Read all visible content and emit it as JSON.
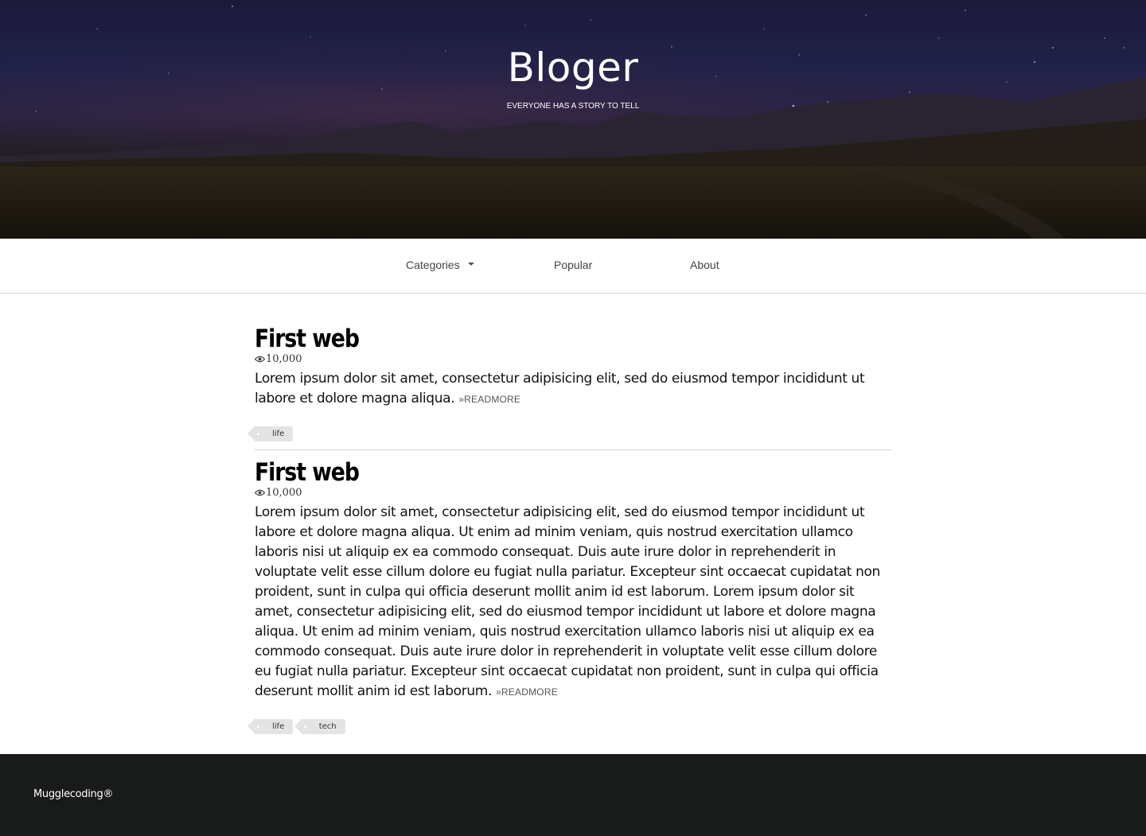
{
  "header": {
    "title": "Bloger",
    "tagline": "EVERYONE HAS A STORY TO TELL"
  },
  "nav": {
    "items": [
      {
        "label": "Categories",
        "icon": "caret-down-icon"
      },
      {
        "label": "Popular"
      },
      {
        "label": "About"
      }
    ]
  },
  "posts": [
    {
      "title": "First web",
      "views": "10,000",
      "excerpt": "Lorem ipsum dolor sit amet, consectetur adipisicing elit, sed do eiusmod tempor incididunt ut labore et dolore magna aliqua.",
      "readmore": "»READMORE",
      "tags": [
        "life"
      ]
    },
    {
      "title": "First web",
      "views": "10,000",
      "excerpt": "Lorem ipsum dolor sit amet, consectetur adipisicing elit, sed do eiusmod tempor incididunt ut labore et dolore magna aliqua. Ut enim ad minim veniam, quis nostrud exercitation ullamco laboris nisi ut aliquip ex ea commodo consequat. Duis aute irure dolor in reprehenderit in voluptate velit esse cillum dolore eu fugiat nulla pariatur. Excepteur sint occaecat cupidatat non proident, sunt in culpa qui officia deserunt mollit anim id est laborum. Lorem ipsum dolor sit amet, consectetur adipisicing elit, sed do eiusmod tempor incididunt ut labore et dolore magna aliqua. Ut enim ad minim veniam, quis nostrud exercitation ullamco laboris nisi ut aliquip ex ea commodo consequat. Duis aute irure dolor in reprehenderit in voluptate velit esse cillum dolore eu fugiat nulla pariatur. Excepteur sint occaecat cupidatat non proident, sunt in culpa qui officia deserunt mollit anim id est laborum.",
      "readmore": "»READMORE",
      "tags": [
        "life",
        "tech"
      ]
    }
  ],
  "icons": {
    "views": "eye-icon",
    "tag": "tag-icon"
  },
  "colors": {
    "footer_bg": "#191a1a",
    "tag_bg": "#e4e4e4",
    "hero_sky": "#1b1a3b"
  },
  "footer": {
    "text": "Mugglecoding®"
  }
}
